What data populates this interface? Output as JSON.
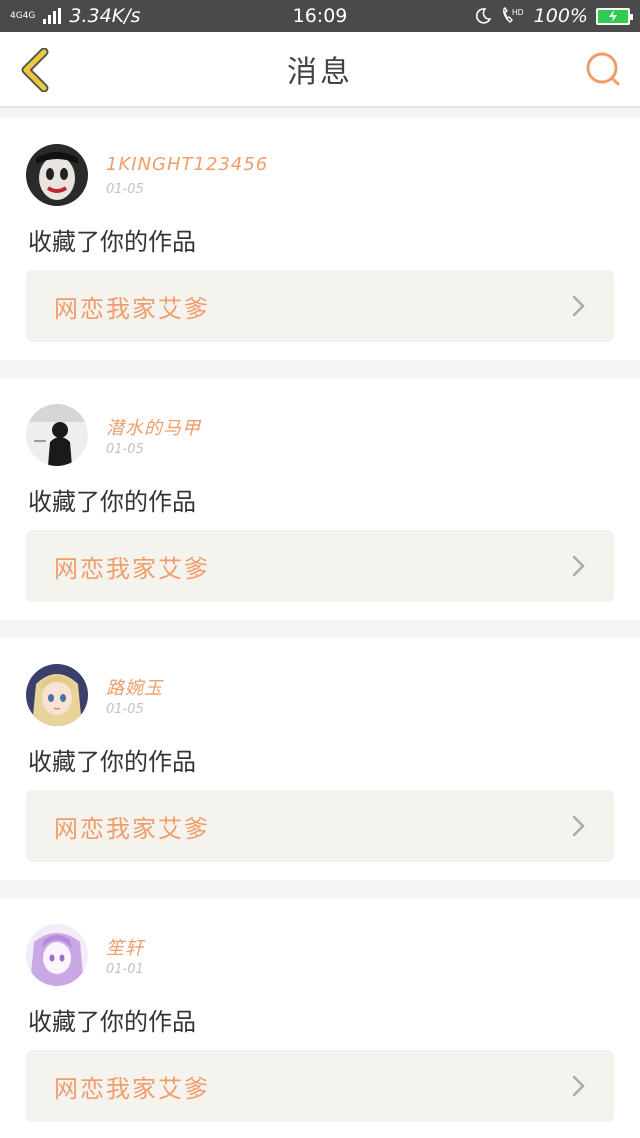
{
  "status_bar": {
    "network_top": "4G4G",
    "speed": "3.34K/s",
    "time": "16:09",
    "battery": "100%"
  },
  "header": {
    "title": "消息"
  },
  "colors": {
    "accent": "#ef9d6c",
    "back_icon": "#f0c93a",
    "card_link_bg": "#f4f3ed"
  },
  "messages": [
    {
      "username": "1KINGHT123456",
      "date": "01-05",
      "action": "收藏了你的作品",
      "work_title": "网恋我家艾爹",
      "avatar": "clown-avatar"
    },
    {
      "username": "潜水的马甲",
      "date": "01-05",
      "action": "收藏了你的作品",
      "work_title": "网恋我家艾爹",
      "avatar": "silhouette-avatar"
    },
    {
      "username": "路婉玉",
      "date": "01-05",
      "action": "收藏了你的作品",
      "work_title": "网恋我家艾爹",
      "avatar": "anime-girl-avatar"
    },
    {
      "username": "笙轩",
      "date": "01-01",
      "action": "收藏了你的作品",
      "work_title": "网恋我家艾爹",
      "avatar": "purple-anime-avatar"
    }
  ]
}
